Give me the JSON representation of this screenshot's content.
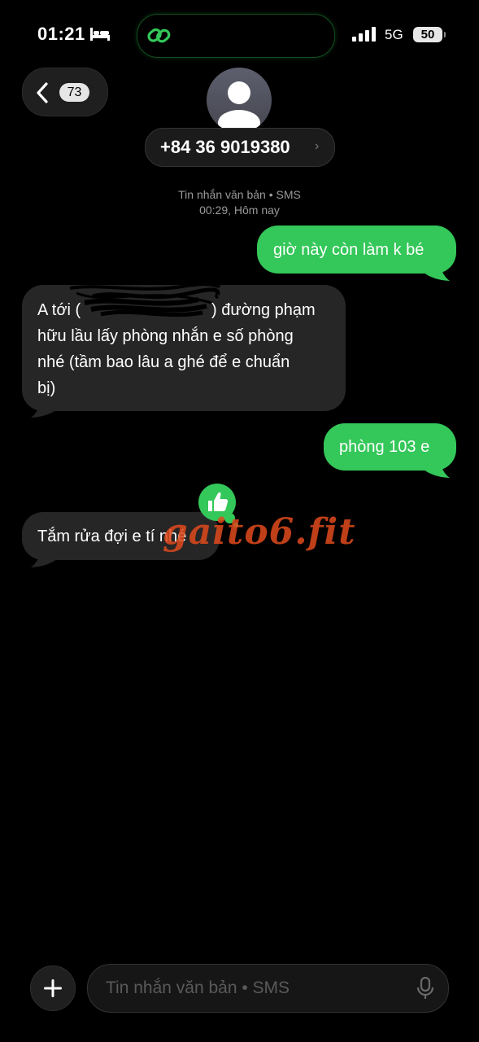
{
  "status_bar": {
    "time": "01:21",
    "network": "5G",
    "battery": "50",
    "icons": [
      "bed-icon",
      "link-icon",
      "signal-icon"
    ]
  },
  "header": {
    "back_count": "73",
    "contact_number": "+84 36 9019380",
    "icons": [
      "chevron-left-icon",
      "person-icon",
      "chevron-right-icon"
    ]
  },
  "conversation": {
    "service_label": "Tin nhắn văn bản • SMS",
    "timestamp": "00:29, Hôm nay",
    "messages": [
      {
        "direction": "outgoing",
        "lines": [
          "giờ này còn làm k bé"
        ]
      },
      {
        "direction": "incoming",
        "lines": [
          "A tới (",
          ") đường phạm",
          "hữu lầu lấy phòng nhắn e số phòng",
          "nhé (tầm bao lâu a ghé để e chuẩn",
          "bị)"
        ],
        "redacted_segment": true
      },
      {
        "direction": "outgoing",
        "lines": [
          "phòng 103 e"
        ]
      },
      {
        "direction": "incoming",
        "lines": [
          "Tắm rửa đợi e tí nhé"
        ],
        "reaction": "thumbs-up-icon"
      }
    ]
  },
  "watermark": "gaito6.fit",
  "composer": {
    "placeholder": "Tin nhắn văn bản • SMS",
    "icons": [
      "plus-icon",
      "microphone-icon"
    ]
  },
  "colors": {
    "outgoing_bubble": "#34c759",
    "incoming_bubble": "#262626",
    "background": "#000000",
    "watermark": "#e04a1d"
  }
}
